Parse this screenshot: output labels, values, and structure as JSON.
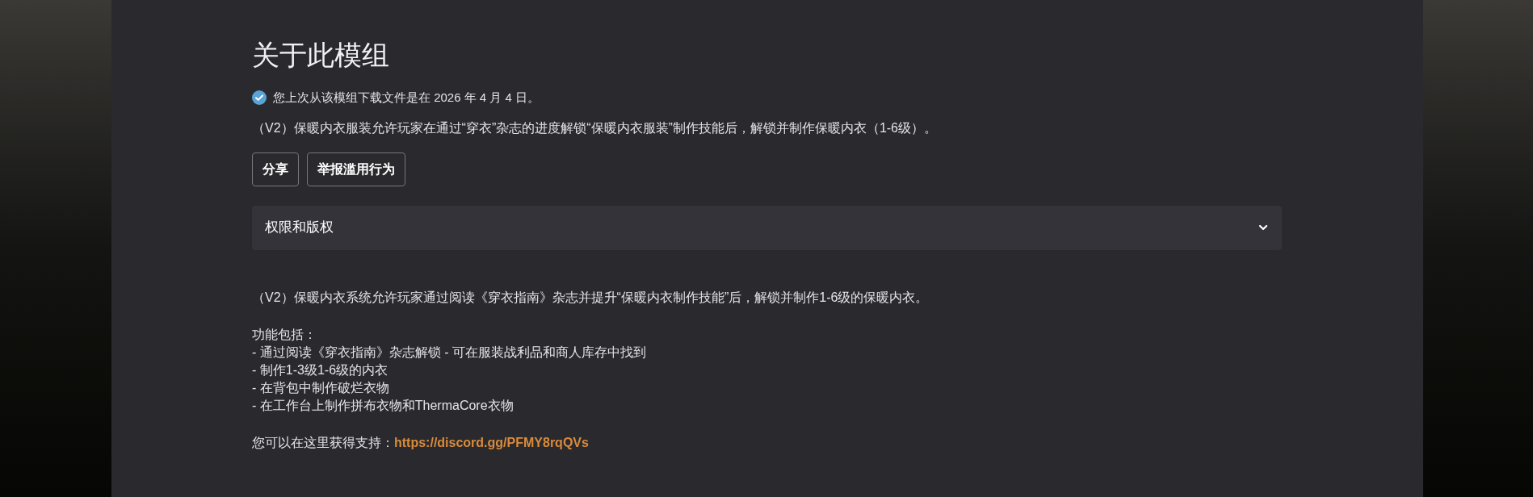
{
  "section": {
    "title": "关于此模组",
    "download_notice": "您上次从该模组下载文件是在 2026 年 4 月 4 日。",
    "summary": "（V2）保暖内衣服装允许玩家在通过“穿衣”杂志的进度解锁“保暖内衣服装”制作技能后，解锁并制作保暖内衣（1-6级）。",
    "buttons": [
      "分享",
      "举报滥用行为"
    ],
    "accordion": {
      "label": "权限和版权",
      "expanded": false
    },
    "description": "（V2）保暖内衣系统允许玩家通过阅读《穿衣指南》杂志并提升“保暖内衣制作技能”后，解锁并制作1-6级的保暖内衣。",
    "features_heading": "功能包括：",
    "features": [
      "- 通过阅读《穿衣指南》杂志解锁 - 可在服装战利品和商人库存中找到",
      "- 制作1-3级1-6级的内衣",
      "- 在背包中制作破烂衣物",
      "- 在工作台上制作拼布衣物和ThermaCore衣物"
    ],
    "support": {
      "text": "您可以在这里获得支持：",
      "link": "https://discord.gg/PFMY8rqQVs"
    }
  }
}
